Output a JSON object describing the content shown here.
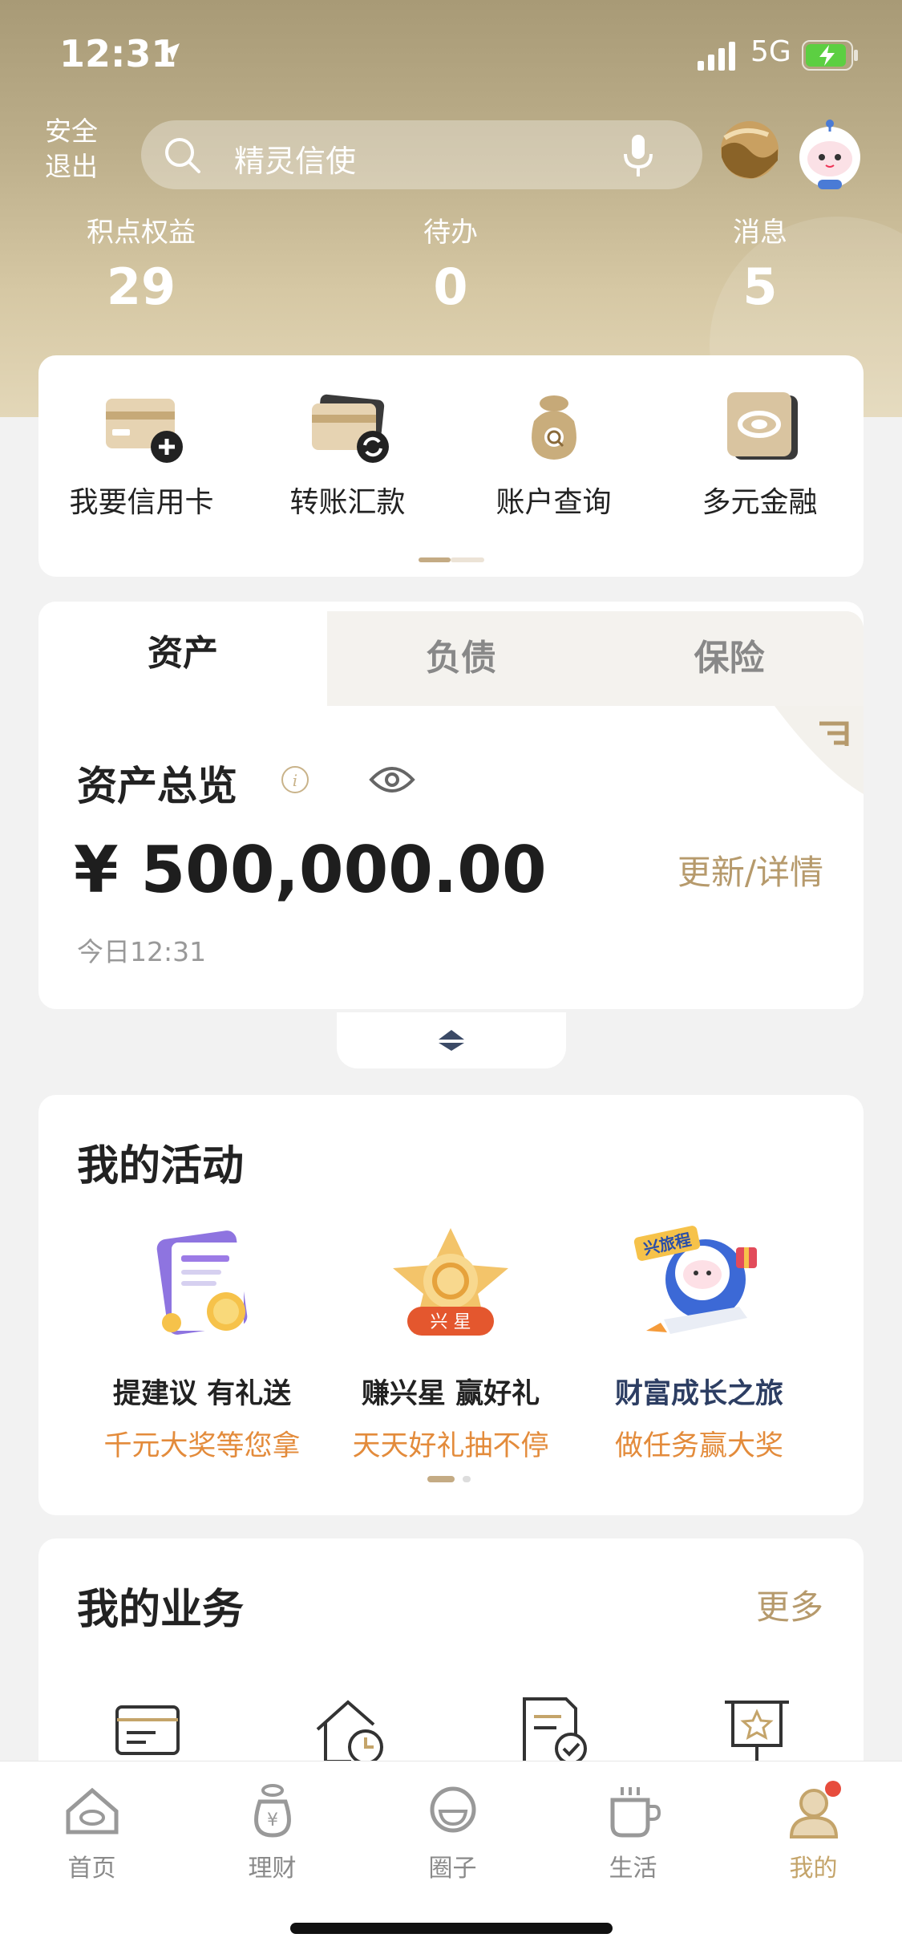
{
  "status": {
    "time": "12:31",
    "network": "5G"
  },
  "header": {
    "exit_label": "安全退出",
    "search_placeholder": "精灵信使",
    "stats": [
      {
        "label": "积点权益",
        "value": "29"
      },
      {
        "label": "待办",
        "value": "0"
      },
      {
        "label": "消息",
        "value": "5"
      }
    ]
  },
  "quick_actions": [
    {
      "label": "我要信用卡",
      "icon": "credit-card-add-icon"
    },
    {
      "label": "转账汇款",
      "icon": "transfer-card-icon"
    },
    {
      "label": "账户查询",
      "icon": "money-bag-search-icon"
    },
    {
      "label": "多元金融",
      "icon": "finance-logo-icon"
    }
  ],
  "assets": {
    "tabs": [
      "资产",
      "负债",
      "保险"
    ],
    "title": "资产总览",
    "amount": "¥ 500,000.00",
    "update_link": "更新/详情",
    "timestamp": "今日12:31"
  },
  "activities": {
    "title": "我的活动",
    "items": [
      {
        "title": "提建议 有礼送",
        "subtitle": "千元大奖等您拿",
        "icon": "suggestion-gift-icon"
      },
      {
        "title": "赚兴星 赢好礼",
        "subtitle": "天天好礼抽不停",
        "icon": "star-badge-icon",
        "badge": "兴 星"
      },
      {
        "title": "财富成长之旅",
        "subtitle": "做任务赢大奖",
        "icon": "astronaut-rocket-icon",
        "badge": "兴旅程"
      }
    ]
  },
  "business": {
    "title": "我的业务",
    "more": "更多"
  },
  "tabbar": [
    {
      "label": "首页",
      "icon": "home-icon"
    },
    {
      "label": "理财",
      "icon": "wealth-icon"
    },
    {
      "label": "圈子",
      "icon": "circle-icon"
    },
    {
      "label": "生活",
      "icon": "coffee-icon"
    },
    {
      "label": "我的",
      "icon": "profile-icon",
      "active": true
    }
  ],
  "colors": {
    "accent": "#c4a46a",
    "orange": "#e38b3b",
    "header": "#bcae8a"
  }
}
